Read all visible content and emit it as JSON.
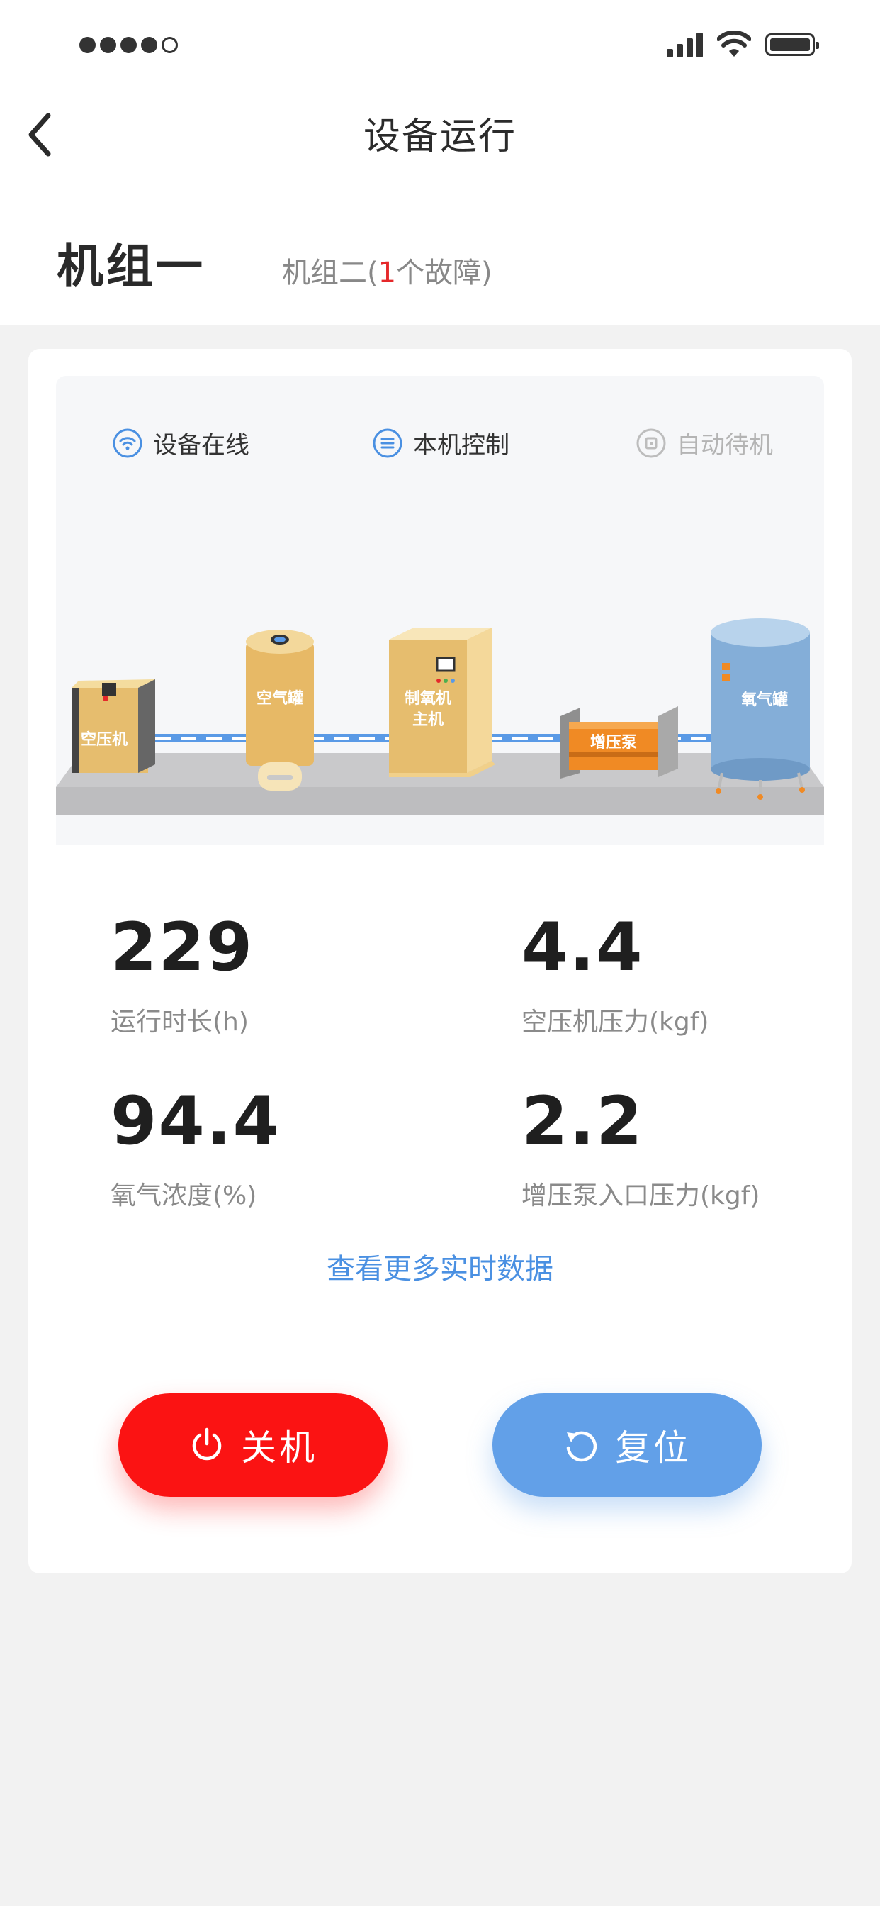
{
  "status_bar": {
    "signal_icon": "cell-signal-icon",
    "wifi_icon": "wifi-icon",
    "battery_icon": "battery-icon"
  },
  "nav": {
    "title": "设备运行",
    "back_icon": "chevron-left-icon"
  },
  "tabs": {
    "active": "机组一",
    "other_prefix": "机组二(",
    "other_fault_count": "1",
    "other_suffix": "个故障)"
  },
  "modes": [
    {
      "label": "设备在线",
      "icon": "wifi-circle-icon",
      "state": "active"
    },
    {
      "label": "本机控制",
      "icon": "menu-circle-icon",
      "state": "active"
    },
    {
      "label": "自动待机",
      "icon": "standby-square-icon",
      "state": "disabled"
    }
  ],
  "equipment": {
    "air_compressor": "空压机",
    "air_tank": "空气罐",
    "oxygen_main_line1": "制氧机",
    "oxygen_main_line2": "主机",
    "booster_pump": "增压泵",
    "oxygen_tank": "氧气罐"
  },
  "stats": [
    {
      "value": "229",
      "label": "运行时长(h)"
    },
    {
      "value": "4.4",
      "label": "空压机压力(kgf)"
    },
    {
      "value": "94.4",
      "label": "氧气浓度(%)"
    },
    {
      "value": "2.2",
      "label": "增压泵入口压力(kgf)"
    }
  ],
  "more_link": "查看更多实时数据",
  "buttons": {
    "shutdown": {
      "label": "关机",
      "icon": "power-icon",
      "color": "#fb1313"
    },
    "reset": {
      "label": "复位",
      "icon": "rotate-ccw-icon",
      "color": "#62a0e8"
    }
  },
  "colors": {
    "accent_blue": "#4a90e2",
    "fault_red": "#e5282a"
  }
}
